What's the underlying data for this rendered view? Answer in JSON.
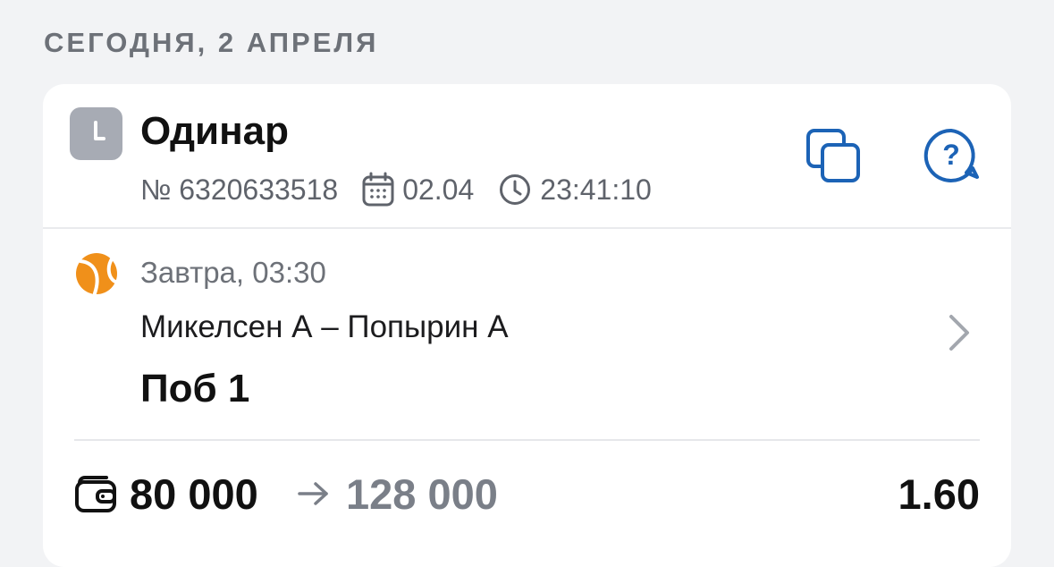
{
  "header": {
    "date_label": "СЕГОДНЯ, 2 АПРЕЛЯ"
  },
  "bet": {
    "type": "Одинар",
    "number": "№ 6320633518",
    "date": "02.04",
    "time": "23:41:10"
  },
  "event": {
    "time": "Завтра, 03:30",
    "name": "Микелсен А – Попырин А",
    "outcome": "Поб 1"
  },
  "stake": {
    "amount": "80 000",
    "payout": "128 000",
    "odds": "1.60"
  },
  "colors": {
    "accent_blue": "#1c63b6",
    "tennis_orange": "#f0901a",
    "muted": "#7a7f88"
  },
  "icons": {
    "type": "clock-icon",
    "calendar": "calendar-icon",
    "time": "clock-outline-icon",
    "copy": "copy-icon",
    "help": "help-chat-icon",
    "sport": "tennis-ball-icon",
    "chevron": "chevron-right-icon",
    "wallet": "wallet-icon",
    "arrow": "arrow-right-icon"
  }
}
